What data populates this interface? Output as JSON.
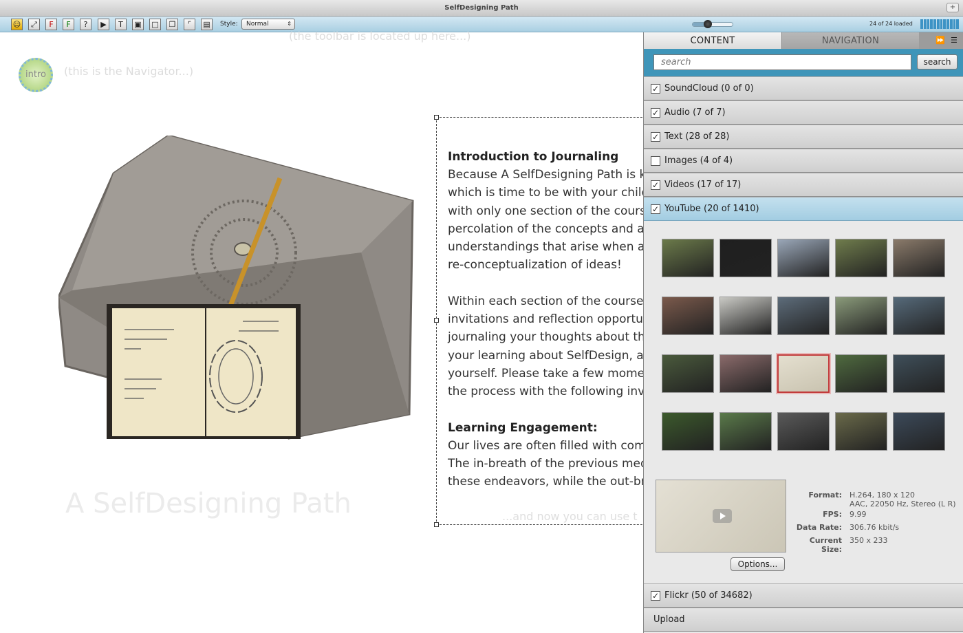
{
  "window": {
    "title": "SelfDesigning Path"
  },
  "toolbar": {
    "style_label": "Style:",
    "style_value": "Normal",
    "loaded_text": "24 of 24 loaded",
    "zoom_fraction": 0.35
  },
  "canvas": {
    "toolbar_hint": "(the toolbar is located up here...)",
    "navigator_label": "intro",
    "navigator_hint": "(this is the Navigator...)",
    "big_title": "A SelfDesigning Path",
    "and_now_hint": "...and now you can use t"
  },
  "textbox": {
    "heading1": "Introduction to Journaling",
    "para1": [
      "Because A SelfDesigning Path is kep",
      "which is time to be with your child a",
      "with only one section of the course",
      "percolation of the concepts and act",
      "understandings that arise when am",
      "re-conceptualization of ideas!"
    ],
    "para2": [
      "Within each section of the course y",
      "invitations and reflection opportuni",
      "journaling your thoughts about the",
      "your learning about SelfDesign, as v",
      "yourself. Please take a few momen",
      "the process with the following invit"
    ],
    "heading2": "Learning Engagement:",
    "para3": [
      "Our lives are often filled with comm",
      "The in-breath of the previous medit",
      "these endeavors, while the out-bre"
    ]
  },
  "panel": {
    "tabs": [
      {
        "label": "CONTENT"
      },
      {
        "label": "NAVIGATION"
      }
    ],
    "search_placeholder": "search",
    "search_button": "search",
    "sections": [
      {
        "label": "SoundCloud (0 of 0)",
        "checked": true
      },
      {
        "label": "Audio (7 of 7)",
        "checked": true
      },
      {
        "label": "Text (28 of 28)",
        "checked": true
      },
      {
        "label": "Images (4 of 4)",
        "checked": false
      },
      {
        "label": "Videos (17 of 17)",
        "checked": true
      },
      {
        "label": "YouTube (20 of 1410)",
        "checked": true
      }
    ],
    "footer_sections": [
      {
        "label": "Flickr (50 of 34682)",
        "checked": true
      }
    ],
    "upload_label": "Upload",
    "thumbnails_colors": [
      "#6b7a4a",
      "#1f1f1f",
      "#9aa7b8",
      "#6f7c4c",
      "#8a7a6a",
      "#7b5a4c",
      "#c9c9c4",
      "#5d6c7a",
      "#8a9a7a",
      "#566a7a",
      "#4a5a3c",
      "#8a6a6a",
      "#d8d2bf",
      "#4f6a3f",
      "#3f4f5a",
      "#3c5a2c",
      "#5a7a4a",
      "#5a5a5a",
      "#6a6a4a",
      "#3c4a5a"
    ],
    "selected_thumbnail": 12,
    "meta": [
      {
        "key": "Format:",
        "value": "H.264, 180 x 120"
      },
      {
        "key": "",
        "value": "AAC, 22050 Hz, Stereo (L R)"
      },
      {
        "key": "FPS:",
        "value": "9.99"
      },
      {
        "key": "Data Rate:",
        "value": "306.76 kbit/s"
      },
      {
        "key": "Current Size:",
        "value": "350 x 233"
      }
    ],
    "options_button": "Options..."
  }
}
